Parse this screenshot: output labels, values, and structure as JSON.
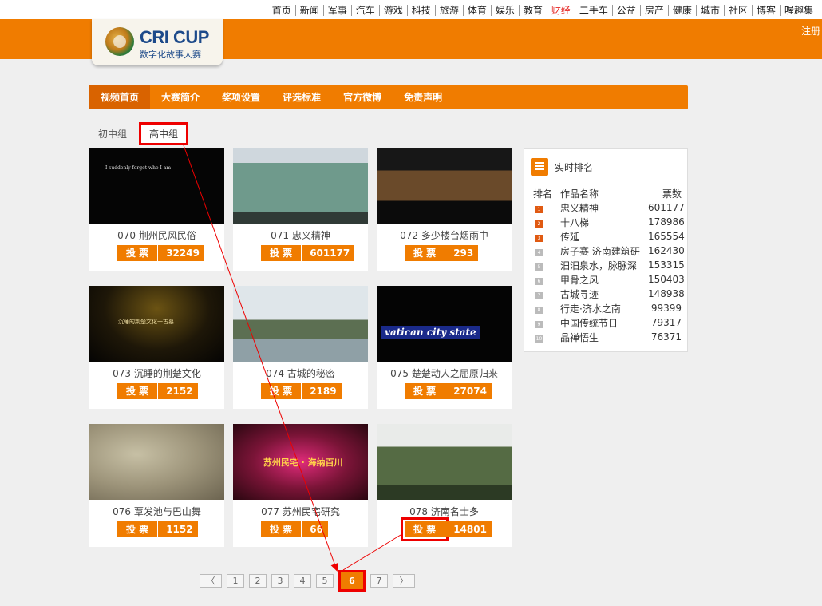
{
  "top_links": [
    "首页",
    "新闻",
    "军事",
    "汽车",
    "游戏",
    "科技",
    "旅游",
    "体育",
    "娱乐",
    "教育",
    "财经",
    "二手车",
    "公益",
    "房产",
    "健康",
    "城市",
    "社区",
    "博客",
    "喔趣集"
  ],
  "register": "注册",
  "logo": {
    "title": "CRI CUP",
    "subtitle": "数字化故事大赛"
  },
  "nav": [
    "视频首页",
    "大赛简介",
    "奖项设置",
    "评选标准",
    "官方微博",
    "免责声明"
  ],
  "groups": [
    "初中组",
    "高中组"
  ],
  "vote_label": "投 票",
  "videos": [
    {
      "title": "070 荆州民风民俗",
      "votes": "32249",
      "thumb_text": "I suddenly forget who I am"
    },
    {
      "title": "071 忠义精神",
      "votes": "601177",
      "thumb_text": ""
    },
    {
      "title": "072 多少楼台烟雨中",
      "votes": "293",
      "thumb_text": ""
    },
    {
      "title": "073 沉睡的荆楚文化",
      "votes": "2152",
      "thumb_text": "沉睡的荆楚文化一古墓"
    },
    {
      "title": "074 古城的秘密",
      "votes": "2189",
      "thumb_text": ""
    },
    {
      "title": "075 楚楚动人之屈原归来",
      "votes": "27074",
      "thumb_text": "vatican city state"
    },
    {
      "title": "076 覃发池与巴山舞",
      "votes": "1152",
      "thumb_text": ""
    },
    {
      "title": "077 苏州民宅研究",
      "votes": "66",
      "thumb_text": "苏州民宅 · 海纳百川"
    },
    {
      "title": "078 济南名士多",
      "votes": "14801",
      "thumb_text": ""
    }
  ],
  "ranking": {
    "title": "实时排名",
    "headers": [
      "排名",
      "作品名称",
      "票数"
    ],
    "rows": [
      {
        "rank": "1",
        "name": "忠义精神",
        "votes": "601177"
      },
      {
        "rank": "2",
        "name": "十八梯",
        "votes": "178986"
      },
      {
        "rank": "3",
        "name": "传延",
        "votes": "165554"
      },
      {
        "rank": "4",
        "name": "房子赛 济南建筑研",
        "votes": "162430"
      },
      {
        "rank": "5",
        "name": "汨汨泉水，脉脉深",
        "votes": "153315"
      },
      {
        "rank": "6",
        "name": "甲骨之风",
        "votes": "150403"
      },
      {
        "rank": "7",
        "name": "古城寻迹",
        "votes": "148938"
      },
      {
        "rank": "8",
        "name": "行走·济水之南",
        "votes": "99399"
      },
      {
        "rank": "9",
        "name": "中国传统节日",
        "votes": "79317"
      },
      {
        "rank": "10",
        "name": "品禅悟生",
        "votes": "76371"
      }
    ]
  },
  "pager": {
    "prev": "〈",
    "pages": [
      "1",
      "2",
      "3",
      "4",
      "5",
      "6",
      "7"
    ],
    "current": "6",
    "next": "〉"
  },
  "colors": {
    "accent": "#f07c00",
    "highlight": "#e00000"
  }
}
